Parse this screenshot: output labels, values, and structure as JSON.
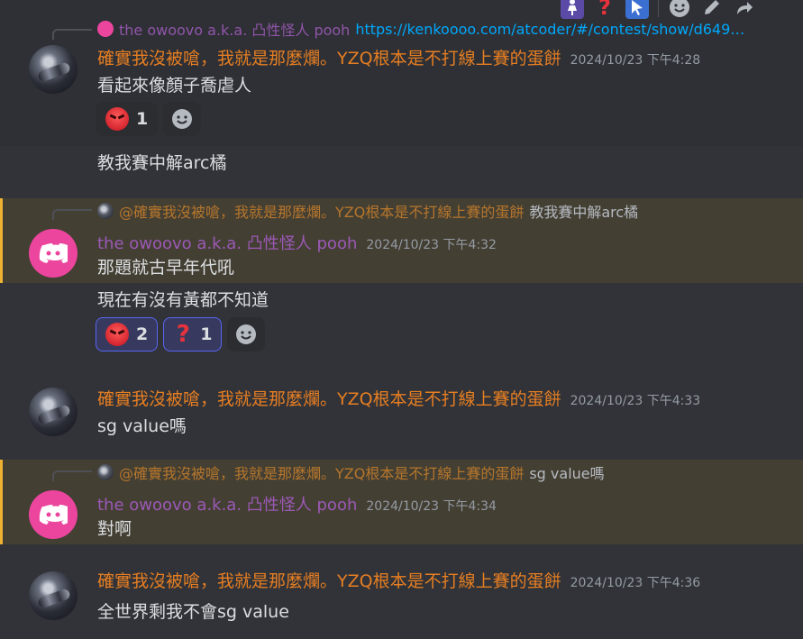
{
  "toolbar": {
    "icons": [
      "pregnant-person-emoji",
      "question-emoji",
      "cursor-emoji",
      "add-reaction",
      "edit",
      "forward"
    ]
  },
  "messages": [
    {
      "reply": {
        "author": "the owoovo a.k.a. 凸性怪人 pooh",
        "text": "https://kenkoooo.com/atcoder/#/contest/show/d649…"
      },
      "author": "確實我沒被嗆，我就是那麼爛。YZQ根本是不打線上賽的蛋餅",
      "timestamp": "2024/10/23 下午4:28",
      "lines": [
        "看起來像顏子喬虐人"
      ],
      "reactions": [
        {
          "emoji": "angry",
          "count": "1"
        }
      ]
    },
    {
      "lines": [
        "教我賽中解arc橘"
      ]
    },
    {
      "reply": {
        "author": "@確實我沒被嗆，我就是那麼爛。YZQ根本是不打線上賽的蛋餅",
        "text": "教我賽中解arc橘"
      },
      "author": "the owoovo a.k.a. 凸性怪人 pooh",
      "timestamp": "2024/10/23 下午4:32",
      "lines": [
        "那題就古早年代吼"
      ]
    },
    {
      "lines": [
        "現在有沒有黃都不知道"
      ],
      "reactions": [
        {
          "emoji": "angry",
          "count": "2"
        },
        {
          "emoji": "question",
          "count": "1"
        }
      ]
    },
    {
      "author": "確實我沒被嗆，我就是那麼爛。YZQ根本是不打線上賽的蛋餅",
      "timestamp": "2024/10/23 下午4:33",
      "lines": [
        "sg value嗎"
      ]
    },
    {
      "reply": {
        "author": "@確實我沒被嗆，我就是那麼爛。YZQ根本是不打線上賽的蛋餅",
        "text": "sg value嗎"
      },
      "author": "the owoovo a.k.a. 凸性怪人 pooh",
      "timestamp": "2024/10/23 下午4:34",
      "lines": [
        "對啊"
      ]
    },
    {
      "author": "確實我沒被嗆，我就是那麼爛。YZQ根本是不打線上賽的蛋餅",
      "timestamp": "2024/10/23 下午4:36",
      "lines": [
        "全世界剩我不會sg value"
      ]
    }
  ],
  "colors": {
    "accent": "#5865f2",
    "mention_bar": "#f0b232",
    "orange_name": "#e67e22",
    "purple_name": "#9b59b6"
  }
}
